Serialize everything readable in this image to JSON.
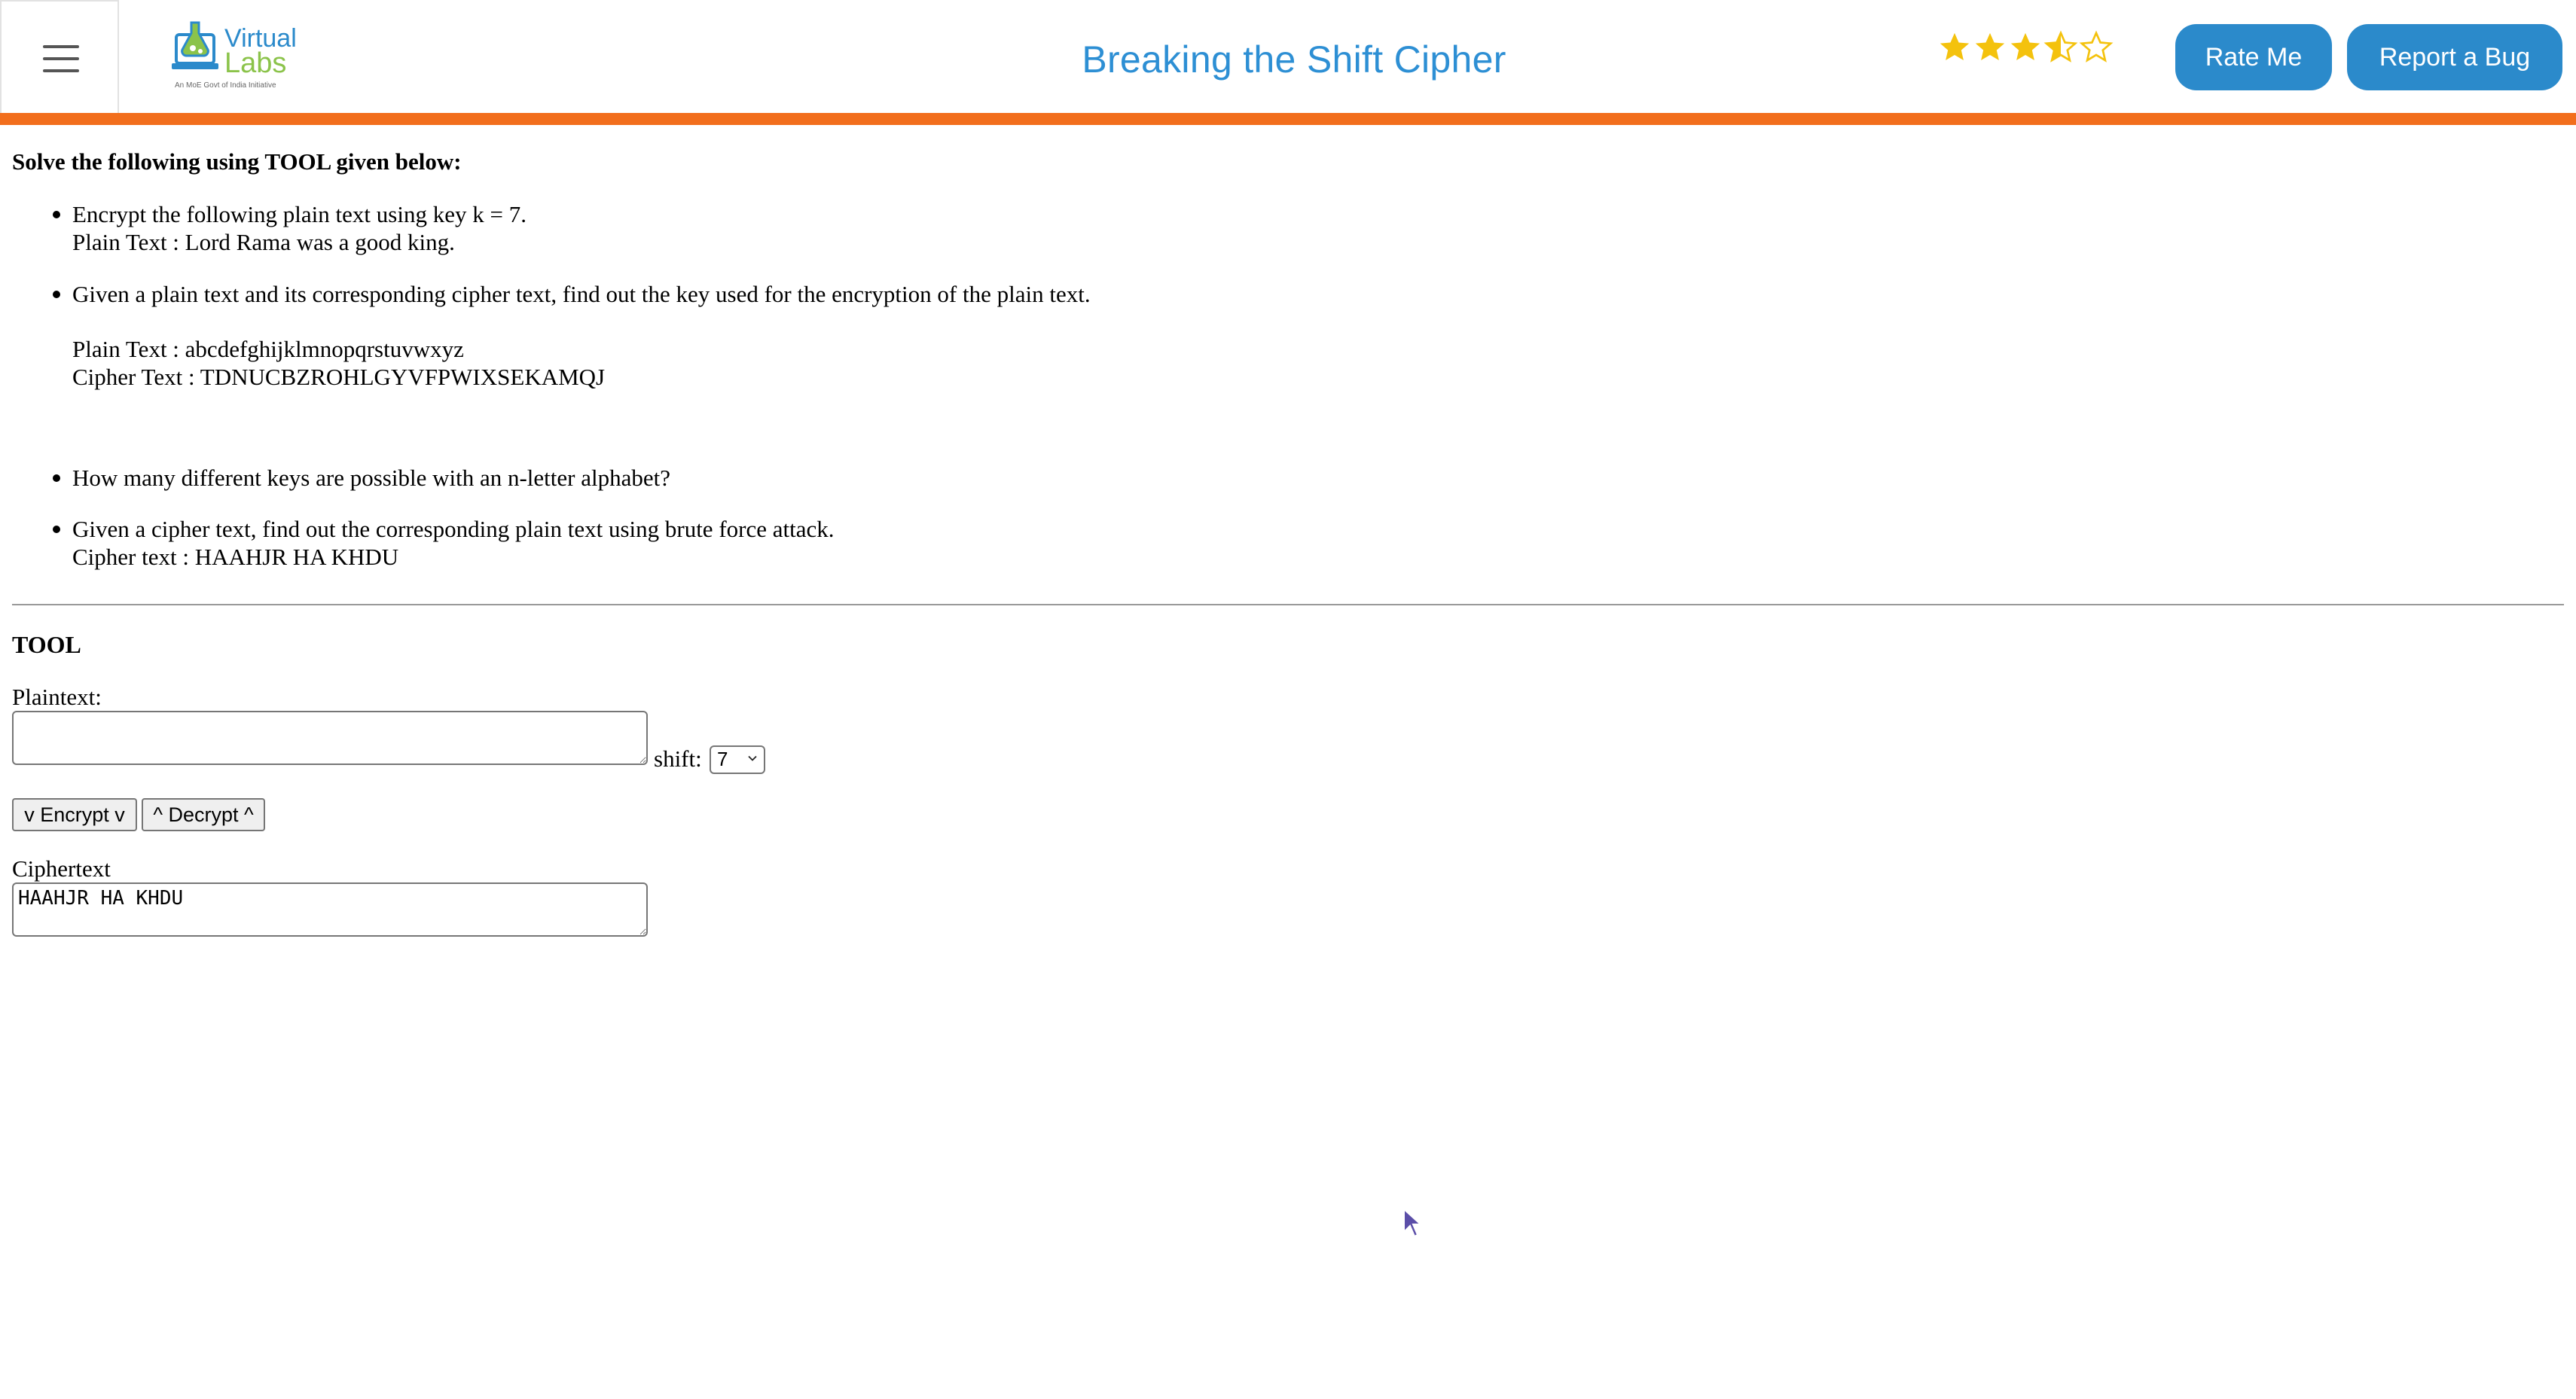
{
  "header": {
    "menu_icon": "hamburger-menu-icon",
    "logo": {
      "name": "Virtual",
      "name_second": "Labs",
      "tagline": "An MoE Govt of India Initiative"
    },
    "title": "Breaking the Shift Cipher",
    "rating": {
      "value": 3.5,
      "max": 5
    },
    "rate_button": "Rate Me",
    "bug_button": "Report a Bug",
    "accent_bar_color": "#f26e1c",
    "title_color": "#2d8fd4",
    "button_color": "#2b8acb",
    "star_color": "#f4c20d"
  },
  "instructions": {
    "heading": "Solve the following using TOOL given below:",
    "items": [
      {
        "lines": [
          "Encrypt the following plain text using key k = 7.",
          "Plain Text : Lord Rama was a good king."
        ]
      },
      {
        "lines": [
          "Given a plain text and its corresponding cipher text, find out the key used for the encryption of the plain text.",
          "Plain Text : abcdefghijklmnopqrstuvwxyz",
          "Cipher Text : TDNUCBZROHLGYVFPWIXSEKAMQJ"
        ]
      },
      {
        "lines": [
          "How many different keys are possible with an n-letter alphabet?"
        ]
      },
      {
        "lines": [
          "Given a cipher text, find out the corresponding plain text using brute force attack.",
          "Cipher text : HAAHJR HA KHDU"
        ]
      }
    ]
  },
  "tool": {
    "heading": "TOOL",
    "plaintext_label": "Plaintext:",
    "plaintext_value": "",
    "shift_label": "shift:",
    "shift_value": "7",
    "encrypt_button": "v Encrypt v",
    "decrypt_button": "^ Decrypt ^",
    "ciphertext_label": "Ciphertext",
    "ciphertext_value": "HAAHJR HA KHDU"
  }
}
